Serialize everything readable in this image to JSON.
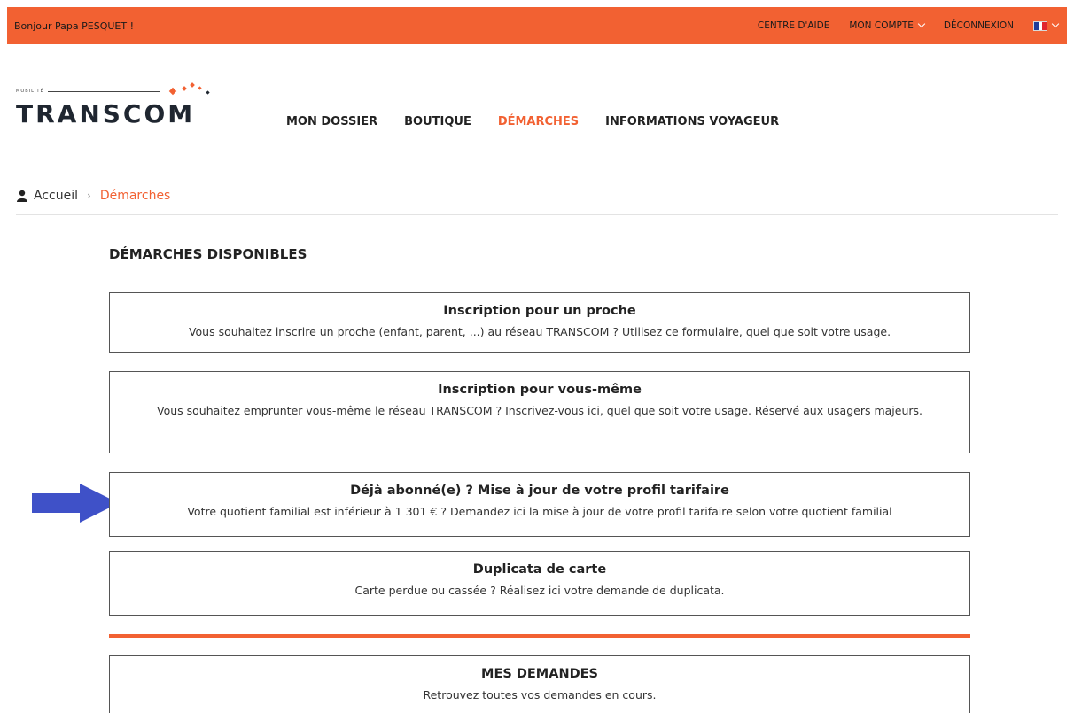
{
  "topbar": {
    "greeting": "Bonjour Papa PESQUET !",
    "help_center": "CENTRE D'AIDE",
    "my_account": "MON COMPTE",
    "logout": "DÉCONNEXION"
  },
  "logo": {
    "small_text": "MOBILITÉ",
    "word": "TRANSCOM"
  },
  "nav": {
    "items": [
      "MON DOSSIER",
      "BOUTIQUE",
      "DÉMARCHES",
      "INFORMATIONS VOYAGEUR"
    ],
    "active": "DÉMARCHES"
  },
  "breadcrumb": {
    "home": "Accueil",
    "separator": "›",
    "current": "Démarches"
  },
  "section_title": "DÉMARCHES DISPONIBLES",
  "cards": [
    {
      "title": "Inscription pour un proche",
      "description": "Vous souhaitez inscrire un proche (enfant, parent, ...) au réseau TRANSCOM ? Utilisez ce formulaire, quel que soit votre usage."
    },
    {
      "title": "Inscription pour vous-même",
      "description": "Vous souhaitez emprunter vous-même le réseau TRANSCOM ? Inscrivez-vous ici, quel que soit votre usage. Réservé aux usagers majeurs."
    },
    {
      "title": "Déjà abonné(e) ? Mise à jour de votre profil tarifaire",
      "description": "Votre quotient familial est inférieur à 1 301 € ? Demandez ici la mise à jour de votre profil tarifaire selon votre quotient familial"
    },
    {
      "title": "Duplicata de carte",
      "description": "Carte perdue ou cassée ? Réalisez ici votre demande de duplicata."
    }
  ],
  "my_requests": {
    "title": "MES DEMANDES",
    "description": "Retrouvez toutes vos demandes en cours."
  },
  "colors": {
    "accent": "#f26132",
    "arrow": "#3f51c8",
    "text": "#222222"
  },
  "icons": [
    "user-icon",
    "chevron-down-icon",
    "france-flag-icon",
    "arrow-right-icon"
  ]
}
